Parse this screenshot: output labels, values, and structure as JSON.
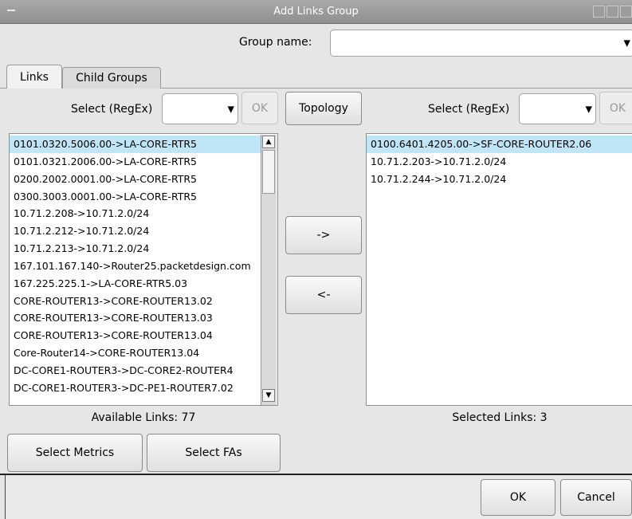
{
  "window": {
    "title": "Add Links Group"
  },
  "group": {
    "label": "Group name:",
    "value": ""
  },
  "tabs": [
    {
      "label": "Links",
      "active": true
    },
    {
      "label": "Child Groups",
      "active": false
    }
  ],
  "left_filter": {
    "label": "Select (RegEx)",
    "value": "",
    "ok_label": "OK"
  },
  "topology_label": "Topology",
  "right_filter": {
    "label": "Select (RegEx)",
    "value": "",
    "ok_label": "OK"
  },
  "available_links": [
    "0101.0320.5006.00->LA-CORE-RTR5",
    "0101.0321.2006.00->LA-CORE-RTR5",
    "0200.2002.0001.00->LA-CORE-RTR5",
    "0300.3003.0001.00->LA-CORE-RTR5",
    "10.71.2.208->10.71.2.0/24",
    "10.71.2.212->10.71.2.0/24",
    "10.71.2.213->10.71.2.0/24",
    "167.101.167.140->Router25.packetdesign.com",
    "167.225.225.1->LA-CORE-RTR5.03",
    "CORE-ROUTER13->CORE-ROUTER13.02",
    "CORE-ROUTER13->CORE-ROUTER13.03",
    "CORE-ROUTER13->CORE-ROUTER13.04",
    "Core-Router14->CORE-ROUTER13.04",
    "DC-CORE1-ROUTER3->DC-CORE2-ROUTER4",
    "DC-CORE1-ROUTER3->DC-PE1-ROUTER7.02"
  ],
  "selected_links": [
    "0100.6401.4205.00->SF-CORE-ROUTER2.06",
    "10.71.2.203->10.71.2.0/24",
    "10.71.2.244->10.71.2.0/24"
  ],
  "add_label": "->",
  "remove_label": "<-",
  "available_caption": "Available Links: 77",
  "selected_caption": "Selected Links: 3",
  "select_metrics_label": "Select Metrics",
  "select_fas_label": "Select FAs",
  "ok_label": "OK",
  "cancel_label": "Cancel",
  "icons": {
    "dropdown": "chevron-down-icon",
    "scroll_up": "arrow-up-icon",
    "scroll_down": "arrow-down-icon",
    "window_menu": "window-menu-icon"
  }
}
